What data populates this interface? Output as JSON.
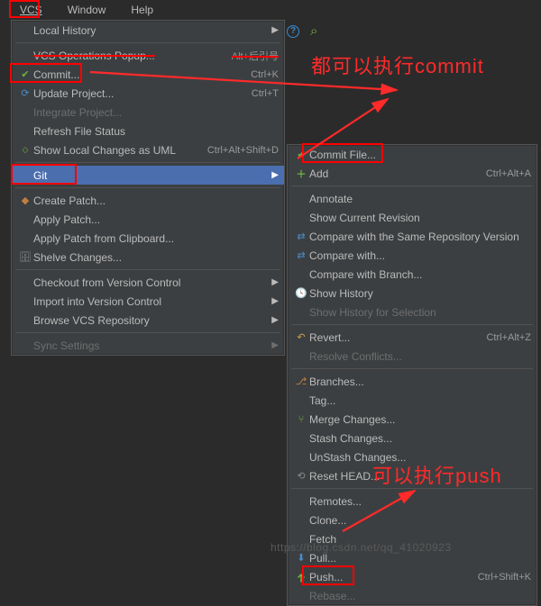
{
  "menubar": {
    "vcs": "VCS",
    "window": "Window",
    "help": "Help"
  },
  "menu1": {
    "local_history": "Local History",
    "vcs_ops": "VCS Operations Popup...",
    "vcs_ops_sc": "Alt+后引号",
    "commit": "Commit...",
    "commit_sc": "Ctrl+K",
    "update": "Update Project...",
    "update_sc": "Ctrl+T",
    "integrate": "Integrate Project...",
    "refresh": "Refresh File Status",
    "show_uml": "Show Local Changes as UML",
    "show_uml_sc": "Ctrl+Alt+Shift+D",
    "git": "Git",
    "create_patch": "Create Patch...",
    "apply_patch": "Apply Patch...",
    "apply_patch_cb": "Apply Patch from Clipboard...",
    "shelve": "Shelve Changes...",
    "checkout_vc": "Checkout from Version Control",
    "import_vc": "Import into Version Control",
    "browse_repo": "Browse VCS Repository",
    "sync": "Sync Settings"
  },
  "menu2": {
    "commit_file": "Commit File...",
    "add": "Add",
    "add_sc": "Ctrl+Alt+A",
    "annotate": "Annotate",
    "show_rev": "Show Current Revision",
    "compare_repo": "Compare with the Same Repository Version",
    "compare_with": "Compare with...",
    "compare_branch": "Compare with Branch...",
    "show_history": "Show History",
    "show_history_sel": "Show History for Selection",
    "revert": "Revert...",
    "revert_sc": "Ctrl+Alt+Z",
    "resolve": "Resolve Conflicts...",
    "branches": "Branches...",
    "tag": "Tag...",
    "merge": "Merge Changes...",
    "stash": "Stash Changes...",
    "unstash": "UnStash Changes...",
    "reset": "Reset HEAD...",
    "remotes": "Remotes...",
    "clone": "Clone...",
    "fetch": "Fetch",
    "pull": "Pull...",
    "push": "Push...",
    "push_sc": "Ctrl+Shift+K",
    "rebase": "Rebase..."
  },
  "annotations": {
    "a1": "都可以执行commit",
    "a2": "可以执行push"
  },
  "watermark": "https://blog.csdn.net/qq_41020923"
}
